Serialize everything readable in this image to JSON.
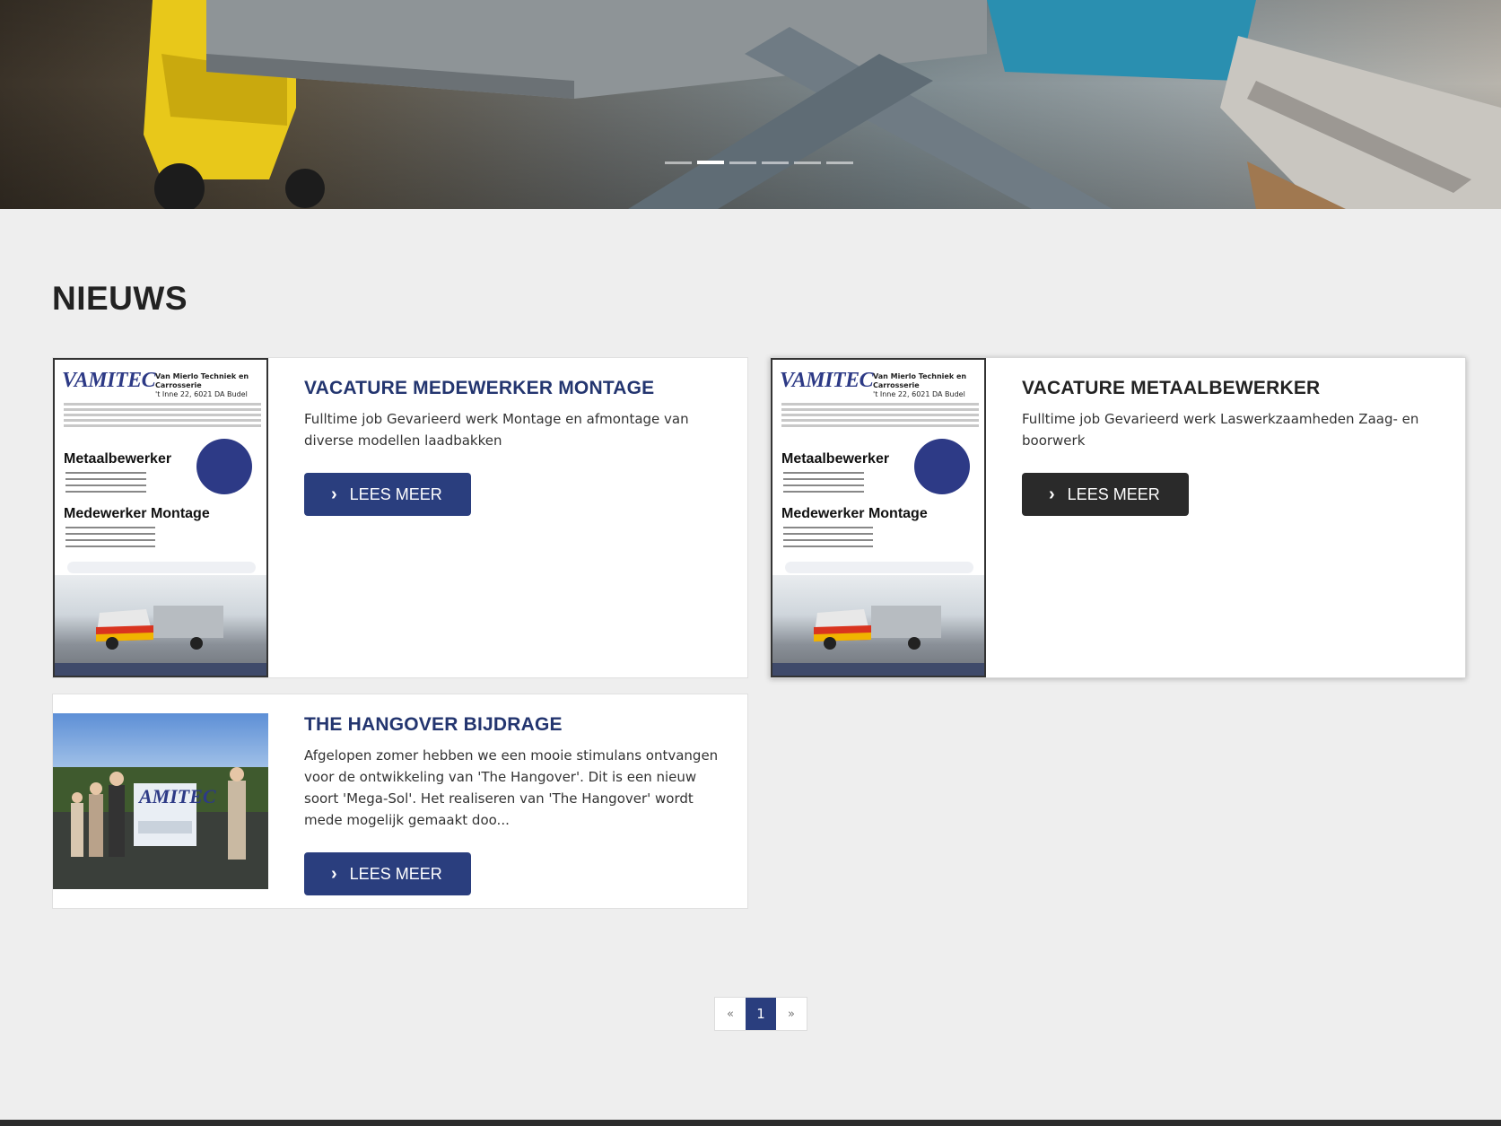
{
  "hero": {
    "slides": [
      {
        "active": false
      },
      {
        "active": true
      },
      {
        "active": false
      },
      {
        "active": false
      },
      {
        "active": false
      },
      {
        "active": false
      }
    ]
  },
  "news": {
    "title": "NIEUWS",
    "items": [
      {
        "title": "VACATURE MEDEWERKER MONTAGE",
        "excerpt": "Fulltime job Gevarieerd werk Montage en afmontage van diverse modellen laadbakken",
        "button": "LEES MEER"
      },
      {
        "title": "VACATURE METAALBEWERKER",
        "excerpt": "Fulltime job Gevarieerd werk Laswerkzaamheden Zaag- en boorwerk",
        "button": "LEES MEER"
      },
      {
        "title": "THE HANGOVER BIJDRAGE",
        "excerpt": "Afgelopen zomer hebben we een mooie stimulans ontvangen voor de ontwikkeling van 'The Hangover'. Dit is een nieuw soort 'Mega-Sol'. Het realiseren van 'The Hangover' wordt mede mogelijk gemaakt doo...",
        "button": "LEES MEER"
      }
    ]
  },
  "poster": {
    "logo": "VAMITEC",
    "company": "Van Mierlo Techniek en Carrosserie",
    "address": "'t Inne 22, 6021 DA Budel",
    "heading1": "Metaalbewerker",
    "heading2": "Medewerker Montage"
  },
  "pagination": {
    "prev": "«",
    "current": "1",
    "next": "»"
  },
  "colors": {
    "primary": "#2a3e7e",
    "dark_button": "#2a2a2a",
    "background": "#eeeeee"
  }
}
